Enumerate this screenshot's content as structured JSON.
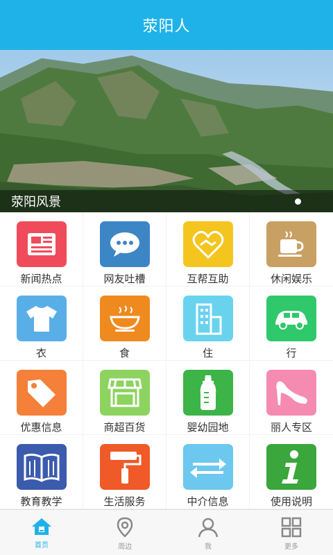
{
  "header": {
    "title": "荥阳人"
  },
  "banner": {
    "caption": "荥阳风景"
  },
  "grid": [
    {
      "label": "新闻热点",
      "icon": "newspaper-icon",
      "color": "#f04b5a"
    },
    {
      "label": "网友吐槽",
      "icon": "chat-bubble-icon",
      "color": "#3d86c6"
    },
    {
      "label": "互帮互助",
      "icon": "handshake-heart-icon",
      "color": "#f4c51f"
    },
    {
      "label": "休闲娱乐",
      "icon": "coffee-cup-icon",
      "color": "#c8a063"
    },
    {
      "label": "衣",
      "icon": "tshirt-icon",
      "color": "#5aaee8"
    },
    {
      "label": "食",
      "icon": "food-bowl-icon",
      "color": "#ef8a1f"
    },
    {
      "label": "住",
      "icon": "building-icon",
      "color": "#69d3ee"
    },
    {
      "label": "行",
      "icon": "car-icon",
      "color": "#2fc86a"
    },
    {
      "label": "优惠信息",
      "icon": "price-tag-icon",
      "color": "#f4803a"
    },
    {
      "label": "商超百货",
      "icon": "store-icon",
      "color": "#8dd35f"
    },
    {
      "label": "婴幼园地",
      "icon": "baby-bottle-icon",
      "color": "#3db447"
    },
    {
      "label": "丽人专区",
      "icon": "high-heel-icon",
      "color": "#f58bb1"
    },
    {
      "label": "教育教学",
      "icon": "open-book-icon",
      "color": "#3b5bad"
    },
    {
      "label": "生活服务",
      "icon": "paint-roller-icon",
      "color": "#ef5a28"
    },
    {
      "label": "中介信息",
      "icon": "exchange-arrows-icon",
      "color": "#6cc8ee"
    },
    {
      "label": "使用说明",
      "icon": "info-icon",
      "color": "#3aa63c"
    }
  ],
  "tabbar": [
    {
      "label": "首页",
      "icon": "home-icon",
      "active": true
    },
    {
      "label": "周边",
      "icon": "location-pin-icon",
      "active": false
    },
    {
      "label": "我",
      "icon": "person-icon",
      "active": false
    },
    {
      "label": "更多",
      "icon": "grid-more-icon",
      "active": false
    }
  ],
  "colors": {
    "accent": "#1fb2e8",
    "tab_inactive": "#999999"
  }
}
